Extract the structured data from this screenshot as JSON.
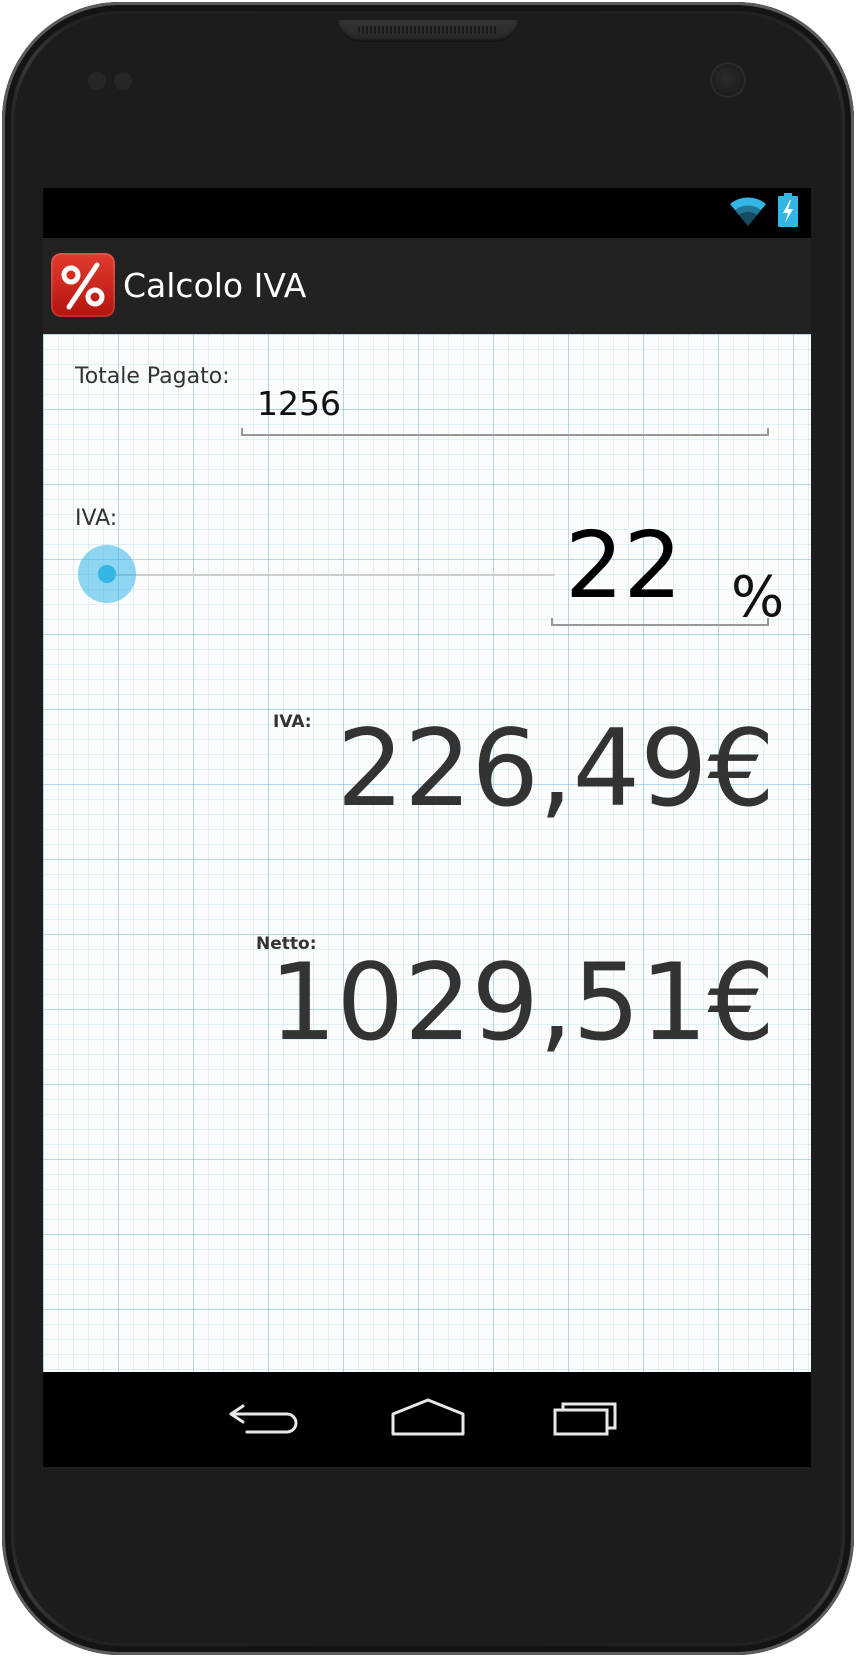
{
  "app": {
    "title": "Calcolo IVA",
    "icon_glyph": "%"
  },
  "status_bar": {
    "icons": [
      "wifi-icon",
      "battery-charging-icon"
    ],
    "accent_color": "#33b5e5"
  },
  "form": {
    "totale_label": "Totale Pagato:",
    "totale_value": "1256",
    "iva_slider_label": "IVA:",
    "iva_percent_value": "22",
    "percent_sign": "%",
    "slider_position": 0.0
  },
  "results": {
    "iva_label": "IVA:",
    "iva_value": "226,49€",
    "netto_label": "Netto:",
    "netto_value": "1029,51€"
  },
  "nav_bar": {
    "buttons": [
      "back-icon",
      "home-icon",
      "recent-apps-icon"
    ]
  },
  "colors": {
    "action_bar": "#222222",
    "icon_red": "#d2261c",
    "slider_blue": "#33b5e5",
    "grid_blue": "#78b4d2"
  }
}
